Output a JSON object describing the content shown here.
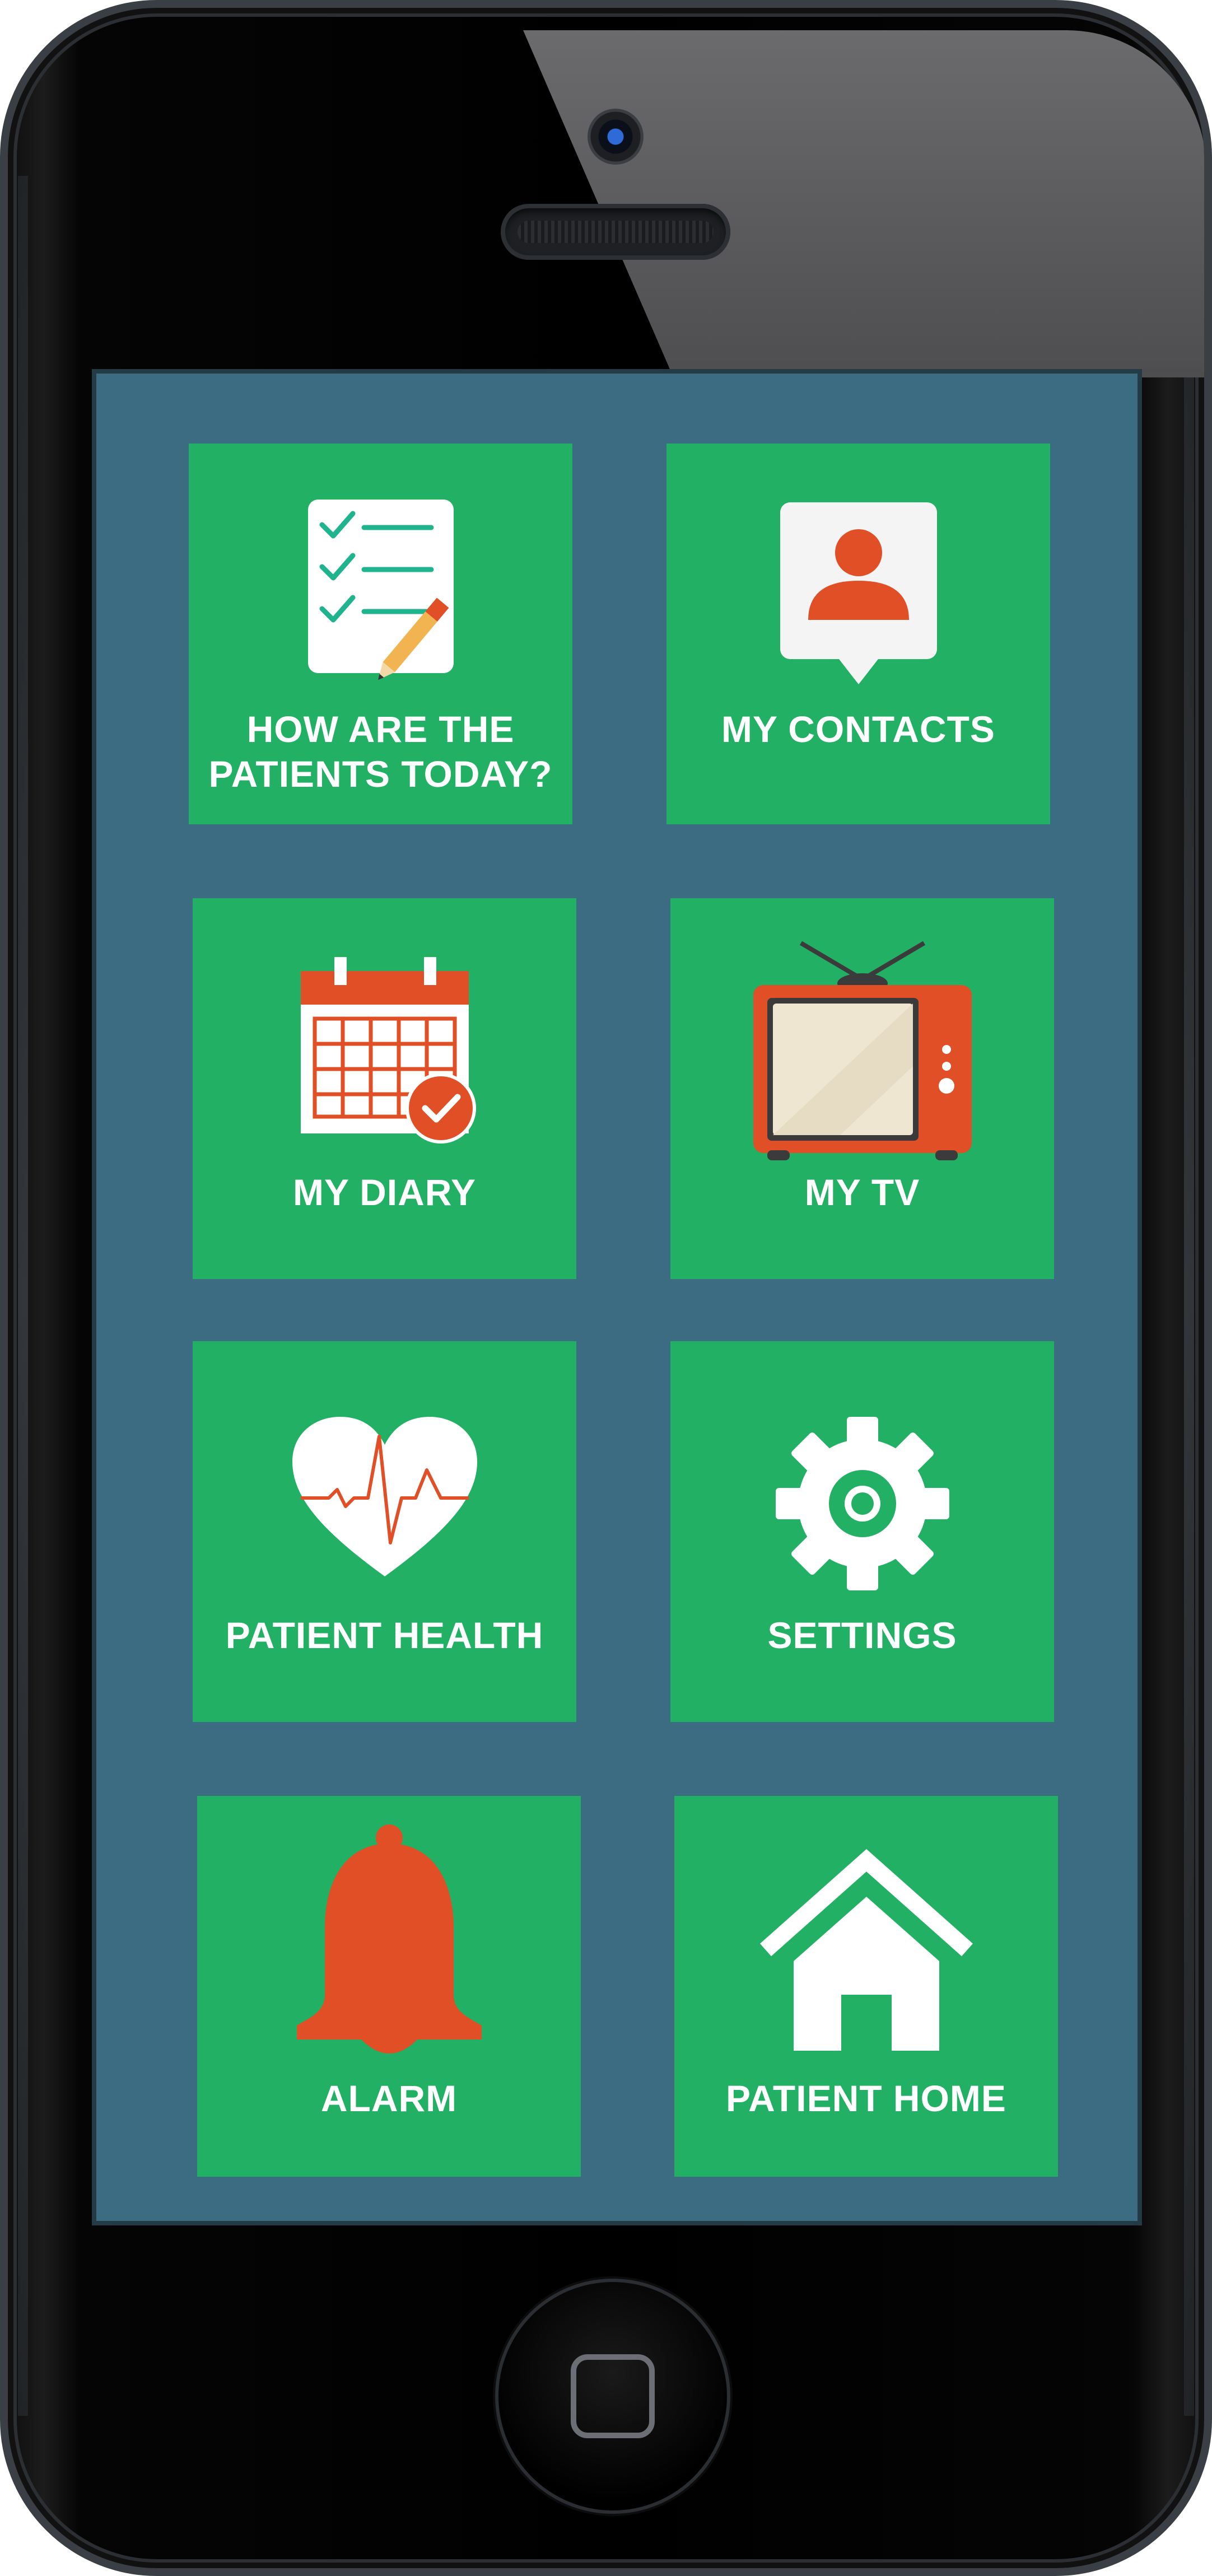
{
  "colors": {
    "screen_background": "#3b6c82",
    "tile_background": "#22b064",
    "icon_accent": "#e04f25",
    "label_color": "#ffffff"
  },
  "tiles": [
    {
      "label_line1": "HOW ARE THE",
      "label_line2": "PATIENTS TODAY?",
      "icon": "checklist-pencil-icon"
    },
    {
      "label": "MY CONTACTS",
      "icon": "contact-card-icon"
    },
    {
      "label": "MY DIARY",
      "icon": "calendar-check-icon"
    },
    {
      "label": "MY TV",
      "icon": "television-icon"
    },
    {
      "label": "PATIENT HEALTH",
      "icon": "heart-pulse-icon"
    },
    {
      "label": "SETTINGS",
      "icon": "gear-icon"
    },
    {
      "label": "ALARM",
      "icon": "bell-icon"
    },
    {
      "label": "PATIENT HOME",
      "icon": "house-icon"
    }
  ]
}
